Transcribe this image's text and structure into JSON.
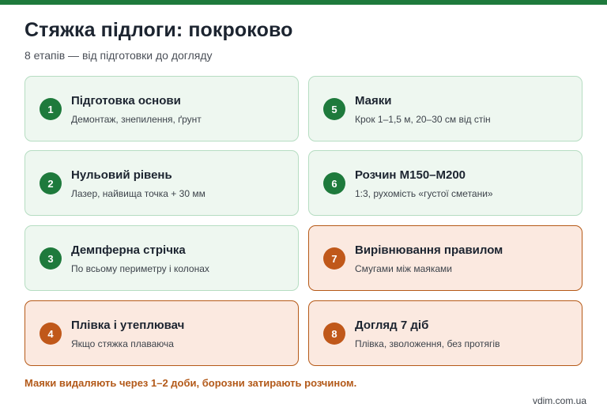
{
  "header": {
    "title": "Стяжка підлоги: покроково",
    "subtitle": "8 етапів — від підготовки до догляду"
  },
  "colors": {
    "accent_green": "#1e7a3c",
    "accent_orange": "#c0581a",
    "card_green_bg": "#eef7f0",
    "card_orange_bg": "#fbe9e0"
  },
  "steps": [
    {
      "number": "1",
      "title": "Підготовка основи",
      "description": "Демонтаж, знепилення, ґрунт",
      "style": "green"
    },
    {
      "number": "2",
      "title": "Нульовий рівень",
      "description": "Лазер, найвища точка + 30 мм",
      "style": "green"
    },
    {
      "number": "3",
      "title": "Демпферна стрічка",
      "description": "По всьому периметру і колонах",
      "style": "green"
    },
    {
      "number": "4",
      "title": "Плівка і утеплювач",
      "description": "Якщо стяжка плаваюча",
      "style": "orange"
    },
    {
      "number": "5",
      "title": "Маяки",
      "description": "Крок 1–1,5 м, 20–30 см від стін",
      "style": "green"
    },
    {
      "number": "6",
      "title": "Розчин М150–М200",
      "description": "1:3, рухомість «густої сметани»",
      "style": "green"
    },
    {
      "number": "7",
      "title": "Вирівнювання правилом",
      "description": "Смугами між маяками",
      "style": "orange"
    },
    {
      "number": "8",
      "title": "Догляд 7 діб",
      "description": "Плівка, зволоження, без протягів",
      "style": "orange"
    }
  ],
  "footnote": "Маяки видаляють через 1–2 доби, борозни затирають розчином.",
  "source": "vdim.com.ua"
}
